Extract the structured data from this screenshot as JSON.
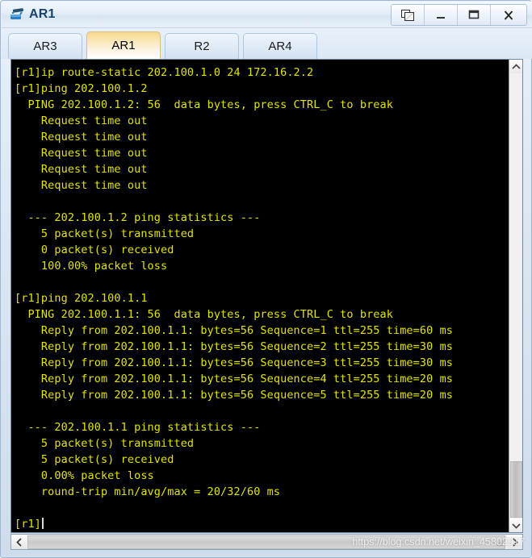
{
  "window": {
    "title": "AR1",
    "app_icon": "router-icon",
    "controls": [
      {
        "name": "restore-windows-button",
        "label": "",
        "icon": "cascade-windows-icon"
      },
      {
        "name": "minimize-button",
        "label": "–",
        "icon": "minimize-icon"
      },
      {
        "name": "maximize-button",
        "label": "□",
        "icon": "maximize-icon"
      },
      {
        "name": "close-button",
        "label": "X",
        "icon": "close-icon"
      }
    ]
  },
  "tabs": {
    "active_index": 1,
    "items": [
      {
        "label": "AR3"
      },
      {
        "label": "AR1"
      },
      {
        "label": "R2"
      },
      {
        "label": "AR4"
      }
    ]
  },
  "terminal": {
    "foreground_color": "#e3e300",
    "background_color": "#000000",
    "prompt": "[r1]",
    "cursor_visible": true,
    "lines": [
      "[r1]ip route-static 202.100.1.0 24 172.16.2.2",
      "[r1]ping 202.100.1.2",
      "  PING 202.100.1.2: 56  data bytes, press CTRL_C to break",
      "    Request time out",
      "    Request time out",
      "    Request time out",
      "    Request time out",
      "    Request time out",
      "",
      "  --- 202.100.1.2 ping statistics ---",
      "    5 packet(s) transmitted",
      "    0 packet(s) received",
      "    100.00% packet loss",
      "",
      "[r1]ping 202.100.1.1",
      "  PING 202.100.1.1: 56  data bytes, press CTRL_C to break",
      "    Reply from 202.100.1.1: bytes=56 Sequence=1 ttl=255 time=60 ms",
      "    Reply from 202.100.1.1: bytes=56 Sequence=2 ttl=255 time=30 ms",
      "    Reply from 202.100.1.1: bytes=56 Sequence=3 ttl=255 time=30 ms",
      "    Reply from 202.100.1.1: bytes=56 Sequence=4 ttl=255 time=20 ms",
      "    Reply from 202.100.1.1: bytes=56 Sequence=5 ttl=255 time=20 ms",
      "",
      "  --- 202.100.1.1 ping statistics ---",
      "    5 packet(s) transmitted",
      "    5 packet(s) received",
      "    0.00% packet loss",
      "    round-trip min/avg/max = 20/32/60 ms",
      "",
      "[r1]"
    ]
  },
  "scrollbars": {
    "vertical": {
      "up_arrow": "⌃",
      "down_arrow": "⌄"
    },
    "horizontal": {
      "left_arrow": "‹",
      "right_arrow": "›"
    }
  },
  "watermark": {
    "text": "https://blog.csdn.net/weixin_45802917"
  }
}
